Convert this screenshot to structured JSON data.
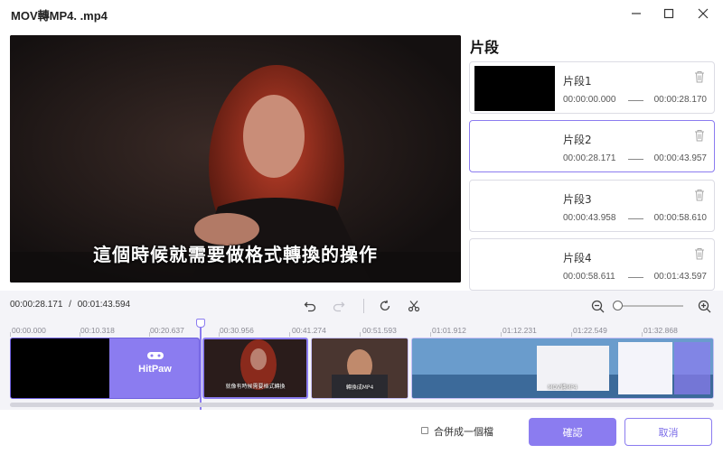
{
  "window": {
    "title": "MOV轉MP4. .mp4"
  },
  "preview": {
    "subtitle": "這個時候就需要做格式轉換的操作"
  },
  "clips_panel": {
    "title": "片段",
    "clips": [
      {
        "name": "片段1",
        "start": "00:00:00.000",
        "end": "00:00:28.170",
        "selected": false
      },
      {
        "name": "片段2",
        "start": "00:00:28.171",
        "end": "00:00:43.957",
        "selected": true
      },
      {
        "name": "片段3",
        "start": "00:00:43.958",
        "end": "00:00:58.610",
        "selected": false
      },
      {
        "name": "片段4",
        "start": "00:00:58.611",
        "end": "00:01:43.597",
        "selected": false
      }
    ]
  },
  "timeline": {
    "current_time": "00:00:28.171",
    "separator": "/",
    "total_time": "00:01:43.594",
    "ruler_labels": [
      "00:00.000",
      "00:10.318",
      "00:20.637",
      "00:30.956",
      "00:41.274",
      "00:51.593",
      "01:01.912",
      "01:12.231",
      "01:22.549",
      "01:32.868"
    ],
    "segments": [
      {
        "brand_text": "HitPaw"
      },
      {
        "caption": "就像有時候需要格式轉換"
      },
      {
        "caption": "轉換成MP4"
      },
      {
        "caption": "MOV轉MP4"
      }
    ]
  },
  "footer": {
    "merge_label": "合併成一個檔",
    "merge_checked": false,
    "confirm_label": "確認",
    "cancel_label": "取消"
  },
  "colors": {
    "accent": "#8b7cf0",
    "timeline_bg": "#f4f4f8"
  }
}
